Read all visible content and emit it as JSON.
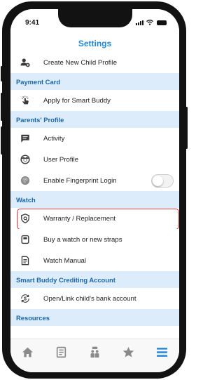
{
  "status_bar": {
    "time": "9:41"
  },
  "header": {
    "title": "Settings"
  },
  "colors": {
    "accent": "#2587d6",
    "section_bg": "#dcecfa",
    "section_text": "#1b66a8",
    "highlight_border": "#d9303c",
    "icon": "#3a3a3a",
    "tab_inactive": "#8a8a8a"
  },
  "rows": {
    "create_child_profile": {
      "label": "Create New Child Profile",
      "icon": "add-user-icon"
    },
    "payment_card_header": "Payment Card",
    "apply_smart_buddy": {
      "label": "Apply for Smart Buddy",
      "icon": "tap-hand-icon"
    },
    "parents_profile_header": "Parents' Profile",
    "activity": {
      "label": "Activity",
      "icon": "chat-bubble-icon"
    },
    "user_profile": {
      "label": "User Profile",
      "icon": "face-icon"
    },
    "fingerprint_login": {
      "label": "Enable Fingerprint Login",
      "icon": "fingerprint-icon",
      "toggle_on": false
    },
    "watch_header": "Watch",
    "warranty": {
      "label": "Warranty / Replacement",
      "icon": "shield-icon",
      "highlighted": true
    },
    "buy_watch": {
      "label": "Buy a watch or new straps",
      "icon": "watch-icon"
    },
    "watch_manual": {
      "label": "Watch Manual",
      "icon": "document-icon"
    },
    "crediting_header": "Smart Buddy Crediting Account",
    "bank_account": {
      "label": "Open/Link child's bank account",
      "icon": "dollar-cycle-icon"
    },
    "resources_header": "Resources"
  },
  "tabbar": {
    "tabs": [
      {
        "icon": "home-icon",
        "active": false
      },
      {
        "icon": "news-icon",
        "active": false
      },
      {
        "icon": "kids-icon",
        "active": false
      },
      {
        "icon": "star-icon",
        "active": false
      },
      {
        "icon": "menu-icon",
        "active": true
      }
    ]
  }
}
